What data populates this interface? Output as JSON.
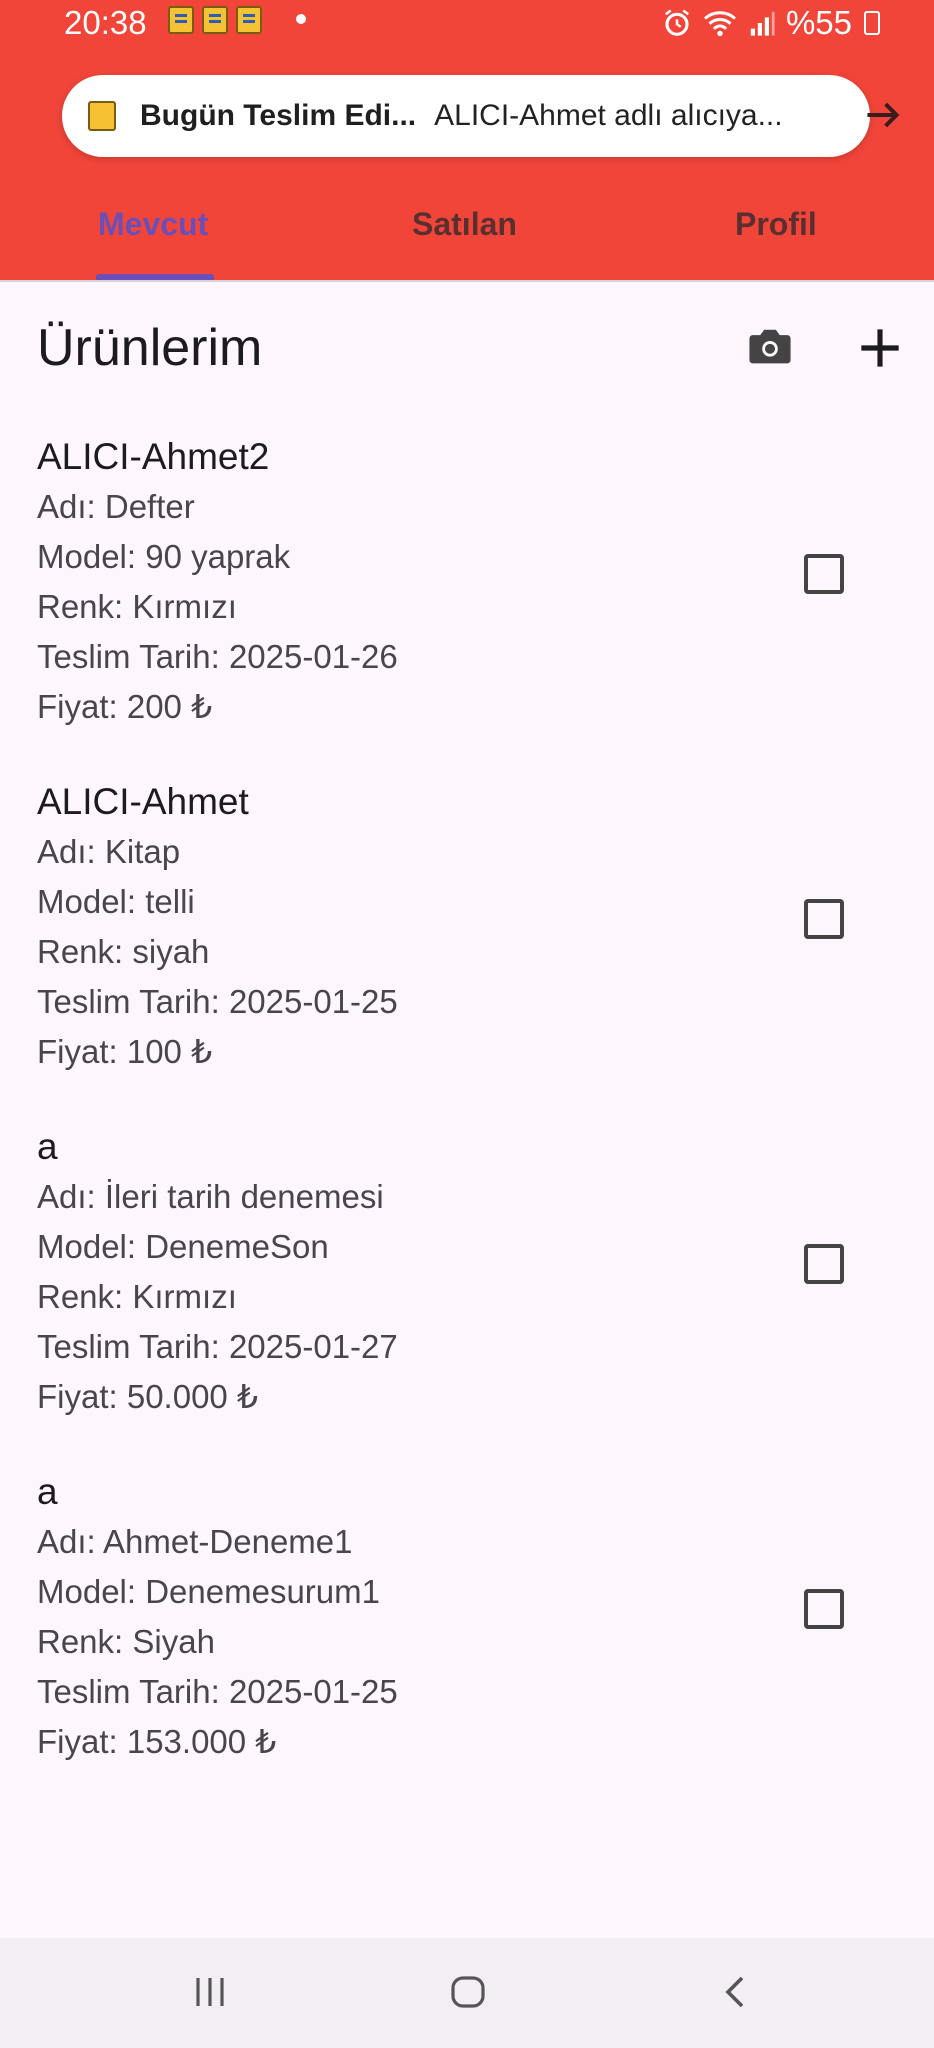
{
  "status_bar": {
    "time": "20:38",
    "battery_text": "%55",
    "icons": [
      "notification-note-icon",
      "alarm-icon",
      "wifi-icon",
      "signal-icon",
      "battery-icon"
    ]
  },
  "notification": {
    "title": "Bugün Teslim Edi...",
    "text": "ALICI-Ahmet  adlı alıcıya..."
  },
  "tabs": [
    {
      "label": "Mevcut",
      "active": true
    },
    {
      "label": "Satılan",
      "active": false
    },
    {
      "label": "Profil",
      "active": false
    }
  ],
  "page": {
    "title": "Ürünlerim"
  },
  "products": [
    {
      "buyer": "ALICI-Ahmet2",
      "name": "Adı: Defter",
      "model": "Model: 90 yaprak",
      "color": "Renk: Kırmızı",
      "date": "Teslim Tarih: 2025-01-26",
      "price": "Fiyat: 200 ₺",
      "checked": false
    },
    {
      "buyer": "ALICI-Ahmet",
      "name": "Adı: Kitap",
      "model": "Model: telli",
      "color": "Renk: siyah",
      "date": "Teslim Tarih: 2025-01-25",
      "price": "Fiyat: 100 ₺",
      "checked": false
    },
    {
      "buyer": "a",
      "name": "Adı: İleri tarih denemesi",
      "model": "Model: DenemeSon",
      "color": "Renk: Kırmızı",
      "date": "Teslim Tarih: 2025-01-27",
      "price": "Fiyat: 50.000 ₺",
      "checked": false
    },
    {
      "buyer": "a",
      "name": "Adı: Ahmet-Deneme1",
      "model": "Model: Denemesurum1",
      "color": "Renk: Siyah",
      "date": "Teslim Tarih: 2025-01-25",
      "price": "Fiyat: 153.000 ₺",
      "checked": false
    }
  ],
  "colors": {
    "app_bar": "#f2453a",
    "tab_active": "#6a4fb8",
    "background": "#fdf7fd"
  }
}
